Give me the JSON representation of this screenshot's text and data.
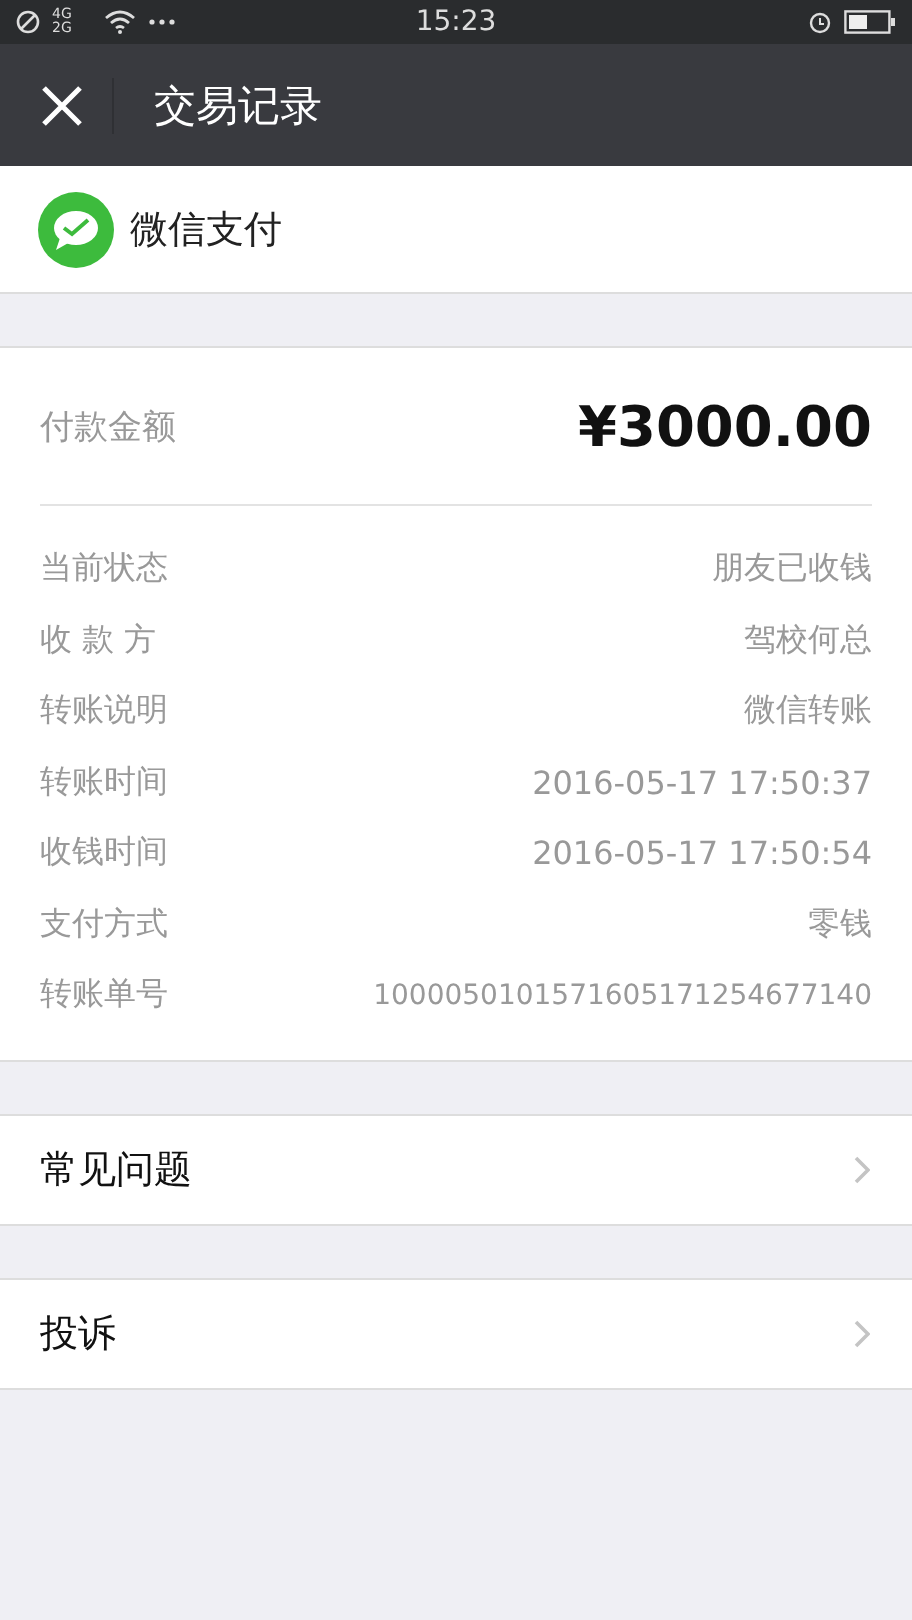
{
  "status_bar": {
    "time": "15:23",
    "signal_text": "4G 2G"
  },
  "nav": {
    "title": "交易记录"
  },
  "provider": {
    "name": "微信支付"
  },
  "amount": {
    "label": "付款金额",
    "value": "¥3000.00"
  },
  "details": [
    {
      "label": "当前状态",
      "value": "朋友已收钱"
    },
    {
      "label": "收 款 方",
      "value": "驾校何总"
    },
    {
      "label": "转账说明",
      "value": "微信转账"
    },
    {
      "label": "转账时间",
      "value": "2016-05-17 17:50:37"
    },
    {
      "label": "收钱时间",
      "value": "2016-05-17 17:50:54"
    },
    {
      "label": "支付方式",
      "value": "零钱"
    },
    {
      "label": "转账单号",
      "value": "1000050101571605171254677140"
    }
  ],
  "links": [
    {
      "label": "常见问题"
    },
    {
      "label": "投诉"
    }
  ]
}
